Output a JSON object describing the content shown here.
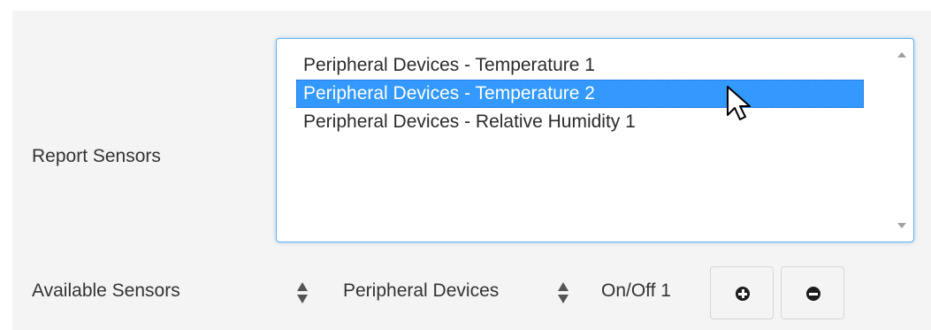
{
  "report_sensors": {
    "label": "Report Sensors",
    "items": [
      {
        "label": "Peripheral Devices - Temperature 1",
        "selected": false
      },
      {
        "label": "Peripheral Devices - Temperature 2",
        "selected": true
      },
      {
        "label": "Peripheral Devices - Relative Humidity 1",
        "selected": false
      }
    ]
  },
  "available_sensors": {
    "label": "Available Sensors",
    "device_type_selected": "Peripheral Devices",
    "sensor_selected": "On/Off 1",
    "add_icon": "plus-circle-icon",
    "remove_icon": "minus-circle-icon"
  },
  "colors": {
    "selection": "#3399ff",
    "focus_border": "#66afe9",
    "panel_bg": "#f4f4f4"
  }
}
